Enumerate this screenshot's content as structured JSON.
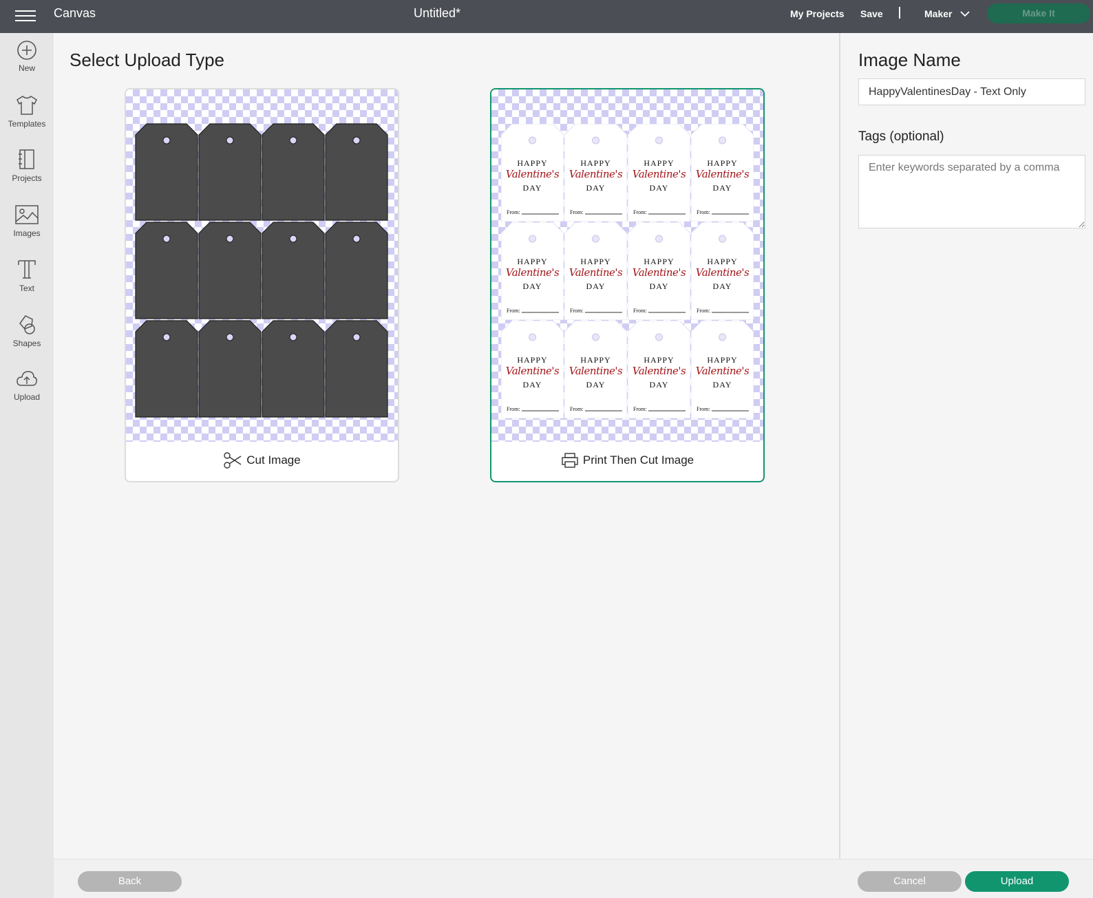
{
  "topbar": {
    "app_title": "Canvas",
    "doc_title": "Untitled*",
    "my_projects": "My Projects",
    "save": "Save",
    "separator": "|",
    "machine": "Maker",
    "make_it": "Make It"
  },
  "sidebar": {
    "items": [
      {
        "label": "New",
        "icon": "plus-circle-icon"
      },
      {
        "label": "Templates",
        "icon": "tshirt-icon"
      },
      {
        "label": "Projects",
        "icon": "notebook-icon"
      },
      {
        "label": "Images",
        "icon": "image-icon"
      },
      {
        "label": "Text",
        "icon": "text-t-icon"
      },
      {
        "label": "Shapes",
        "icon": "shapes-icon"
      },
      {
        "label": "Upload",
        "icon": "cloud-upload-icon"
      }
    ]
  },
  "main": {
    "title": "Select Upload Type",
    "cards": [
      {
        "label": "Cut Image",
        "icon": "scissors-icon",
        "selected": false
      },
      {
        "label": "Print Then Cut Image",
        "icon": "printer-icon",
        "selected": true
      }
    ],
    "tag_text": {
      "line1": "HAPPY",
      "line2": "Valentine's",
      "line3": "DAY",
      "from": "From:"
    }
  },
  "right_panel": {
    "title": "Image Name",
    "name_value": "HappyValentinesDay - Text Only",
    "tags_label": "Tags (optional)",
    "tags_placeholder": "Enter keywords separated by a comma"
  },
  "bottom": {
    "back": "Back",
    "cancel": "Cancel",
    "upload": "Upload"
  },
  "colors": {
    "topbar": "#4b4e54",
    "accent": "#11956f",
    "tag_fill": "#4b4b4b",
    "valentine_red": "#a4161a"
  }
}
